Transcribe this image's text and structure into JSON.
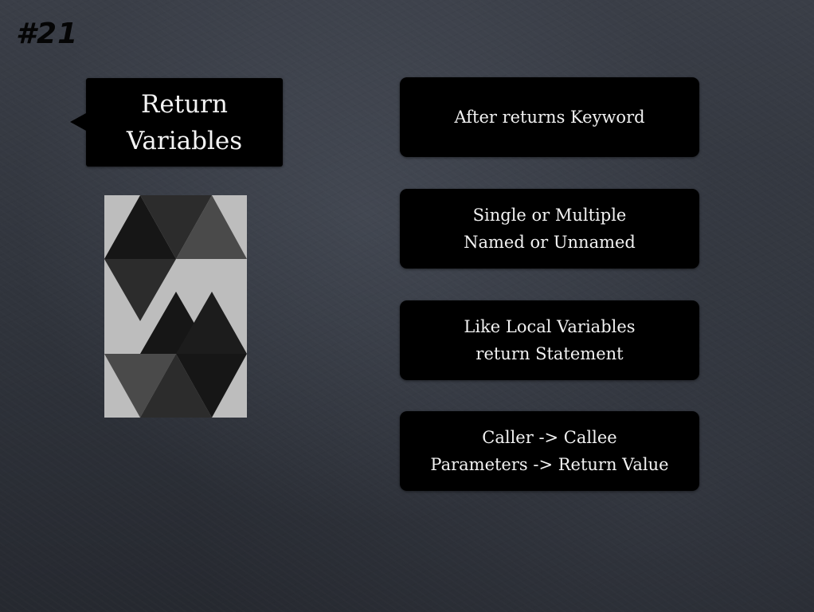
{
  "slide": {
    "number": "#21",
    "title": "Return\nVariables",
    "logo": {
      "icon": "solidity-logo-icon",
      "colors": {
        "background": "#bdbdbd",
        "dark": "#161616",
        "medium": "#2c2c2c",
        "light": "#4a4a4a"
      }
    },
    "points": [
      {
        "text": "After returns Keyword"
      },
      {
        "text": "Single or Multiple\nNamed or Unnamed"
      },
      {
        "text": "Like Local Variables\nreturn Statement"
      },
      {
        "text": "Caller -> Callee\nParameters -> Return Value"
      }
    ]
  }
}
